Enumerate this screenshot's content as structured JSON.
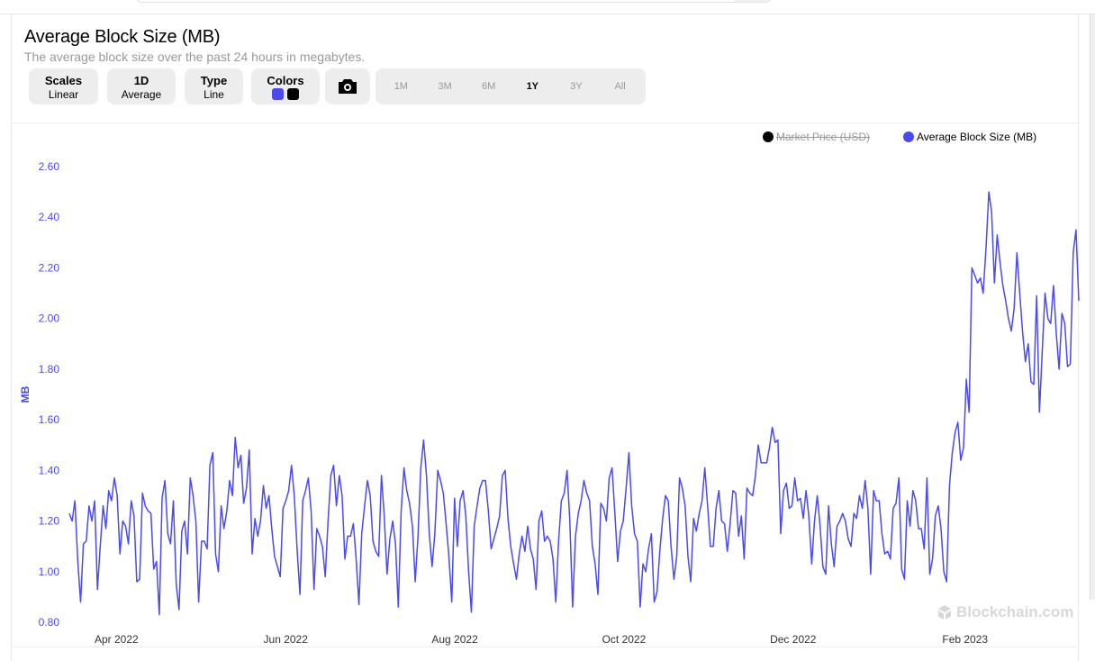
{
  "header": {
    "title": "Average Block Size (MB)",
    "subtitle": "The average block size over the past 24 hours in megabytes."
  },
  "controls": {
    "scales": {
      "title": "Scales",
      "value": "Linear"
    },
    "period": {
      "title": "1D",
      "value": "Average"
    },
    "type": {
      "title": "Type",
      "value": "Line"
    },
    "colors": {
      "title": "Colors",
      "swatches": [
        "#4a4af0",
        "#000000"
      ]
    },
    "screenshot_icon": "camera-icon",
    "ranges": [
      "1M",
      "3M",
      "6M",
      "1Y",
      "3Y",
      "All"
    ],
    "active_range": "1Y"
  },
  "watermark": "Blockchain.com",
  "chart_data": {
    "type": "line",
    "title": "Average Block Size (MB)",
    "ylabel": "MB",
    "xlabel": "",
    "ylim": [
      0.8,
      2.6
    ],
    "yticks": [
      "0.80",
      "1.00",
      "1.20",
      "1.40",
      "1.60",
      "1.80",
      "2.00",
      "2.20",
      "2.40",
      "2.60"
    ],
    "x_range": [
      "2022-03-15",
      "2023-03-14"
    ],
    "xticks": [
      {
        "label": "Apr 2022",
        "date": "2022-04-01"
      },
      {
        "label": "Jun 2022",
        "date": "2022-06-01"
      },
      {
        "label": "Aug 2022",
        "date": "2022-08-01"
      },
      {
        "label": "Oct 2022",
        "date": "2022-10-01"
      },
      {
        "label": "Dec 2022",
        "date": "2022-12-01"
      },
      {
        "label": "Feb 2023",
        "date": "2023-02-01"
      }
    ],
    "legend": [
      {
        "name": "Market Price (USD)",
        "color": "#000000",
        "hidden": true
      },
      {
        "name": "Average Block Size (MB)",
        "color": "#4a4af0",
        "hidden": false
      }
    ],
    "legend_position": "top-right",
    "grid": false,
    "series": [
      {
        "name": "Average Block Size (MB)",
        "color": "#4a4af0",
        "values": [
          1.23,
          1.2,
          1.28,
          1.04,
          0.88,
          1.11,
          1.12,
          1.26,
          1.2,
          1.28,
          0.93,
          1.1,
          1.26,
          1.17,
          1.32,
          1.28,
          1.37,
          1.3,
          1.07,
          1.2,
          1.18,
          1.11,
          1.28,
          1.22,
          0.96,
          0.97,
          1.31,
          1.26,
          1.24,
          1.23,
          1.01,
          1.04,
          0.83,
          1.29,
          1.36,
          1.15,
          1.11,
          1.28,
          0.95,
          0.85,
          1.16,
          1.2,
          1.07,
          1.37,
          1.3,
          1.2,
          0.88,
          1.12,
          1.12,
          1.09,
          1.42,
          1.47,
          1.07,
          1.0,
          1.26,
          1.17,
          1.24,
          1.36,
          1.3,
          1.53,
          1.41,
          1.46,
          1.27,
          1.33,
          1.48,
          1.07,
          1.21,
          1.14,
          1.2,
          1.34,
          1.25,
          1.3,
          1.17,
          1.06,
          1.02,
          0.98,
          1.25,
          1.28,
          1.32,
          1.42,
          1.3,
          1.09,
          0.91,
          1.28,
          1.32,
          1.37,
          1.24,
          0.93,
          1.17,
          1.14,
          1.1,
          0.98,
          1.2,
          1.38,
          1.42,
          1.26,
          1.38,
          1.3,
          1.05,
          1.14,
          1.14,
          1.19,
          1.05,
          0.87,
          1.15,
          1.26,
          1.36,
          1.3,
          1.12,
          1.08,
          1.06,
          1.38,
          1.22,
          0.99,
          1.13,
          1.2,
          1.11,
          0.86,
          1.24,
          1.41,
          1.32,
          1.27,
          1.18,
          0.96,
          1.14,
          1.41,
          1.52,
          1.38,
          1.15,
          1.02,
          1.15,
          1.4,
          1.36,
          1.31,
          1.19,
          1.06,
          0.88,
          1.29,
          1.1,
          1.28,
          1.32,
          1.22,
          1.0,
          0.84,
          1.18,
          1.26,
          1.33,
          1.36,
          1.36,
          1.24,
          1.09,
          1.13,
          1.17,
          1.22,
          1.38,
          1.4,
          1.21,
          1.1,
          1.03,
          0.97,
          1.07,
          1.14,
          1.08,
          1.18,
          1.09,
          1.05,
          0.93,
          1.2,
          1.24,
          1.12,
          1.14,
          1.12,
          1.05,
          0.88,
          1.12,
          1.28,
          1.31,
          1.4,
          1.2,
          0.86,
          1.14,
          1.23,
          1.28,
          1.36,
          1.31,
          1.28,
          1.1,
          1.03,
          0.91,
          1.27,
          1.25,
          1.2,
          1.37,
          1.41,
          1.23,
          1.04,
          1.16,
          1.2,
          1.33,
          1.47,
          1.26,
          1.15,
          1.12,
          0.86,
          1.03,
          1.0,
          1.09,
          1.15,
          0.88,
          0.92,
          1.08,
          1.21,
          1.3,
          1.28,
          1.1,
          0.97,
          1.06,
          1.37,
          1.33,
          1.26,
          1.06,
          0.96,
          1.21,
          1.16,
          1.23,
          1.28,
          1.41,
          1.26,
          1.1,
          1.1,
          1.25,
          1.32,
          1.2,
          1.19,
          1.08,
          1.19,
          1.32,
          1.31,
          1.14,
          1.22,
          1.05,
          1.33,
          1.31,
          1.3,
          1.38,
          1.5,
          1.43,
          1.43,
          1.43,
          1.49,
          1.57,
          1.51,
          1.52,
          1.15,
          1.32,
          1.35,
          1.25,
          1.26,
          1.37,
          1.28,
          1.29,
          1.21,
          1.32,
          1.22,
          1.03,
          1.2,
          1.3,
          1.18,
          1.02,
          0.99,
          1.26,
          1.11,
          1.02,
          1.18,
          1.2,
          1.23,
          1.2,
          1.13,
          1.1,
          1.23,
          1.21,
          1.3,
          1.25,
          1.36,
          1.25,
          0.99,
          1.32,
          1.28,
          1.28,
          1.15,
          1.07,
          1.08,
          1.05,
          1.25,
          1.27,
          1.37,
          1.01,
          0.97,
          1.28,
          1.18,
          1.32,
          1.28,
          1.17,
          1.17,
          1.09,
          1.37,
          0.99,
          1.05,
          1.22,
          1.26,
          1.17,
          1.0,
          0.96,
          1.34,
          1.47,
          1.55,
          1.59,
          1.44,
          1.49,
          1.76,
          1.63,
          2.2,
          2.17,
          2.14,
          2.16,
          2.1,
          2.28,
          2.5,
          2.42,
          2.14,
          2.33,
          2.22,
          2.13,
          2.07,
          2.0,
          1.95,
          2.04,
          2.26,
          2.1,
          1.95,
          1.83,
          1.9,
          1.75,
          1.74,
          2.09,
          1.63,
          1.87,
          2.1,
          2.0,
          1.98,
          2.13,
          1.94,
          1.8,
          2.02,
          1.98,
          1.81,
          1.82,
          2.26,
          2.35,
          2.07
        ]
      }
    ]
  }
}
